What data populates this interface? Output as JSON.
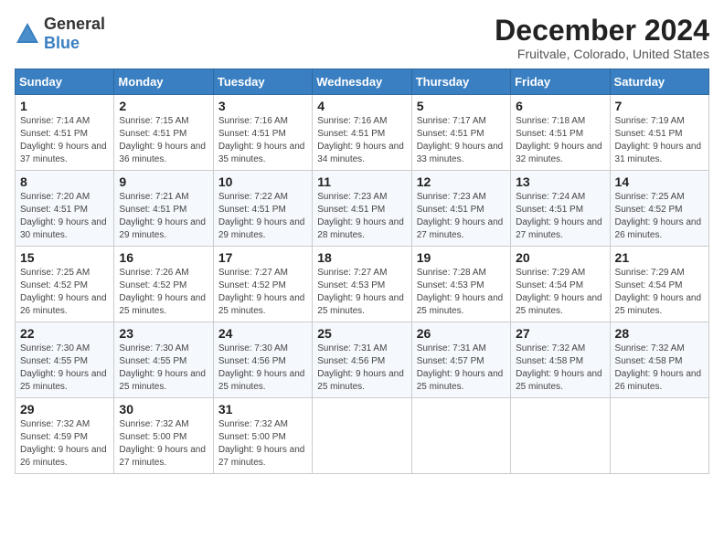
{
  "header": {
    "logo_general": "General",
    "logo_blue": "Blue",
    "title": "December 2024",
    "subtitle": "Fruitvale, Colorado, United States"
  },
  "calendar": {
    "days_of_week": [
      "Sunday",
      "Monday",
      "Tuesday",
      "Wednesday",
      "Thursday",
      "Friday",
      "Saturday"
    ],
    "weeks": [
      [
        null,
        null,
        null,
        null,
        null,
        null,
        null
      ]
    ],
    "cells": [
      {
        "day": 1,
        "col": 0,
        "sunrise": "7:14 AM",
        "sunset": "4:51 PM",
        "daylight": "9 hours and 37 minutes."
      },
      {
        "day": 2,
        "col": 1,
        "sunrise": "7:15 AM",
        "sunset": "4:51 PM",
        "daylight": "9 hours and 36 minutes."
      },
      {
        "day": 3,
        "col": 2,
        "sunrise": "7:16 AM",
        "sunset": "4:51 PM",
        "daylight": "9 hours and 35 minutes."
      },
      {
        "day": 4,
        "col": 3,
        "sunrise": "7:16 AM",
        "sunset": "4:51 PM",
        "daylight": "9 hours and 34 minutes."
      },
      {
        "day": 5,
        "col": 4,
        "sunrise": "7:17 AM",
        "sunset": "4:51 PM",
        "daylight": "9 hours and 33 minutes."
      },
      {
        "day": 6,
        "col": 5,
        "sunrise": "7:18 AM",
        "sunset": "4:51 PM",
        "daylight": "9 hours and 32 minutes."
      },
      {
        "day": 7,
        "col": 6,
        "sunrise": "7:19 AM",
        "sunset": "4:51 PM",
        "daylight": "9 hours and 31 minutes."
      },
      {
        "day": 8,
        "col": 0,
        "sunrise": "7:20 AM",
        "sunset": "4:51 PM",
        "daylight": "9 hours and 30 minutes."
      },
      {
        "day": 9,
        "col": 1,
        "sunrise": "7:21 AM",
        "sunset": "4:51 PM",
        "daylight": "9 hours and 29 minutes."
      },
      {
        "day": 10,
        "col": 2,
        "sunrise": "7:22 AM",
        "sunset": "4:51 PM",
        "daylight": "9 hours and 29 minutes."
      },
      {
        "day": 11,
        "col": 3,
        "sunrise": "7:23 AM",
        "sunset": "4:51 PM",
        "daylight": "9 hours and 28 minutes."
      },
      {
        "day": 12,
        "col": 4,
        "sunrise": "7:23 AM",
        "sunset": "4:51 PM",
        "daylight": "9 hours and 27 minutes."
      },
      {
        "day": 13,
        "col": 5,
        "sunrise": "7:24 AM",
        "sunset": "4:51 PM",
        "daylight": "9 hours and 27 minutes."
      },
      {
        "day": 14,
        "col": 6,
        "sunrise": "7:25 AM",
        "sunset": "4:52 PM",
        "daylight": "9 hours and 26 minutes."
      },
      {
        "day": 15,
        "col": 0,
        "sunrise": "7:25 AM",
        "sunset": "4:52 PM",
        "daylight": "9 hours and 26 minutes."
      },
      {
        "day": 16,
        "col": 1,
        "sunrise": "7:26 AM",
        "sunset": "4:52 PM",
        "daylight": "9 hours and 25 minutes."
      },
      {
        "day": 17,
        "col": 2,
        "sunrise": "7:27 AM",
        "sunset": "4:52 PM",
        "daylight": "9 hours and 25 minutes."
      },
      {
        "day": 18,
        "col": 3,
        "sunrise": "7:27 AM",
        "sunset": "4:53 PM",
        "daylight": "9 hours and 25 minutes."
      },
      {
        "day": 19,
        "col": 4,
        "sunrise": "7:28 AM",
        "sunset": "4:53 PM",
        "daylight": "9 hours and 25 minutes."
      },
      {
        "day": 20,
        "col": 5,
        "sunrise": "7:29 AM",
        "sunset": "4:54 PM",
        "daylight": "9 hours and 25 minutes."
      },
      {
        "day": 21,
        "col": 6,
        "sunrise": "7:29 AM",
        "sunset": "4:54 PM",
        "daylight": "9 hours and 25 minutes."
      },
      {
        "day": 22,
        "col": 0,
        "sunrise": "7:30 AM",
        "sunset": "4:55 PM",
        "daylight": "9 hours and 25 minutes."
      },
      {
        "day": 23,
        "col": 1,
        "sunrise": "7:30 AM",
        "sunset": "4:55 PM",
        "daylight": "9 hours and 25 minutes."
      },
      {
        "day": 24,
        "col": 2,
        "sunrise": "7:30 AM",
        "sunset": "4:56 PM",
        "daylight": "9 hours and 25 minutes."
      },
      {
        "day": 25,
        "col": 3,
        "sunrise": "7:31 AM",
        "sunset": "4:56 PM",
        "daylight": "9 hours and 25 minutes."
      },
      {
        "day": 26,
        "col": 4,
        "sunrise": "7:31 AM",
        "sunset": "4:57 PM",
        "daylight": "9 hours and 25 minutes."
      },
      {
        "day": 27,
        "col": 5,
        "sunrise": "7:32 AM",
        "sunset": "4:58 PM",
        "daylight": "9 hours and 25 minutes."
      },
      {
        "day": 28,
        "col": 6,
        "sunrise": "7:32 AM",
        "sunset": "4:58 PM",
        "daylight": "9 hours and 26 minutes."
      },
      {
        "day": 29,
        "col": 0,
        "sunrise": "7:32 AM",
        "sunset": "4:59 PM",
        "daylight": "9 hours and 26 minutes."
      },
      {
        "day": 30,
        "col": 1,
        "sunrise": "7:32 AM",
        "sunset": "5:00 PM",
        "daylight": "9 hours and 27 minutes."
      },
      {
        "day": 31,
        "col": 2,
        "sunrise": "7:32 AM",
        "sunset": "5:00 PM",
        "daylight": "9 hours and 27 minutes."
      }
    ]
  }
}
